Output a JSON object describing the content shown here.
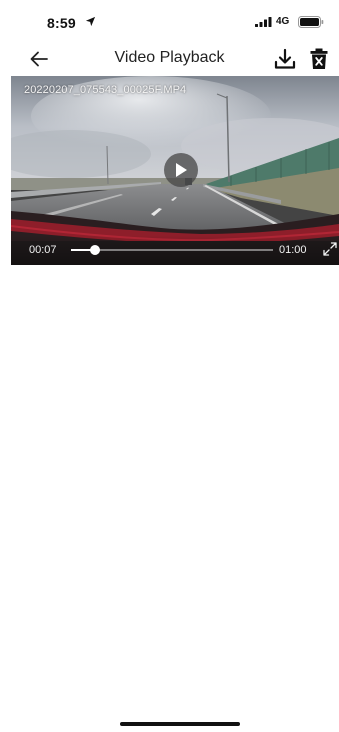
{
  "status_bar": {
    "time": "8:59",
    "network": "4G",
    "icons": [
      "location-arrow-icon",
      "signal-bars-icon",
      "battery-icon"
    ]
  },
  "nav": {
    "title": "Video Playback",
    "icons": [
      "arrow-left-icon",
      "download-icon",
      "trash-icon"
    ]
  },
  "video": {
    "filename": "20220207_075543_00025F.MP4",
    "current_time": "00:07",
    "duration": "01:00",
    "progress_fraction": 0.12,
    "state": "paused",
    "icons": [
      "play-icon",
      "fullscreen-icon"
    ]
  },
  "colors": {
    "title_text": "#222222",
    "background": "#ffffff",
    "seek_played": "#ffffff"
  }
}
